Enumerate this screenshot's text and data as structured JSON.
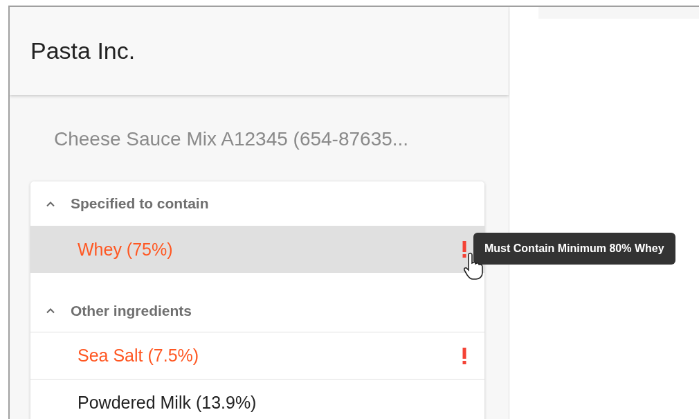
{
  "app": {
    "title": "Pasta Inc."
  },
  "product": {
    "title": "Cheese Sauce Mix A12345 (654-87635..."
  },
  "groups": [
    {
      "label": "Specified to contain",
      "expanded": true,
      "items": [
        {
          "name": "Whey (75%)",
          "flagged": true,
          "selected": true,
          "tooltip": "Must Contain Minimum 80% Whey"
        }
      ]
    },
    {
      "label": "Other ingredients",
      "expanded": true,
      "items": [
        {
          "name": "Sea Salt (7.5%)",
          "flagged": true,
          "selected": false
        },
        {
          "name": "Powdered Milk (13.9%)",
          "flagged": false,
          "selected": false
        }
      ]
    }
  ]
}
